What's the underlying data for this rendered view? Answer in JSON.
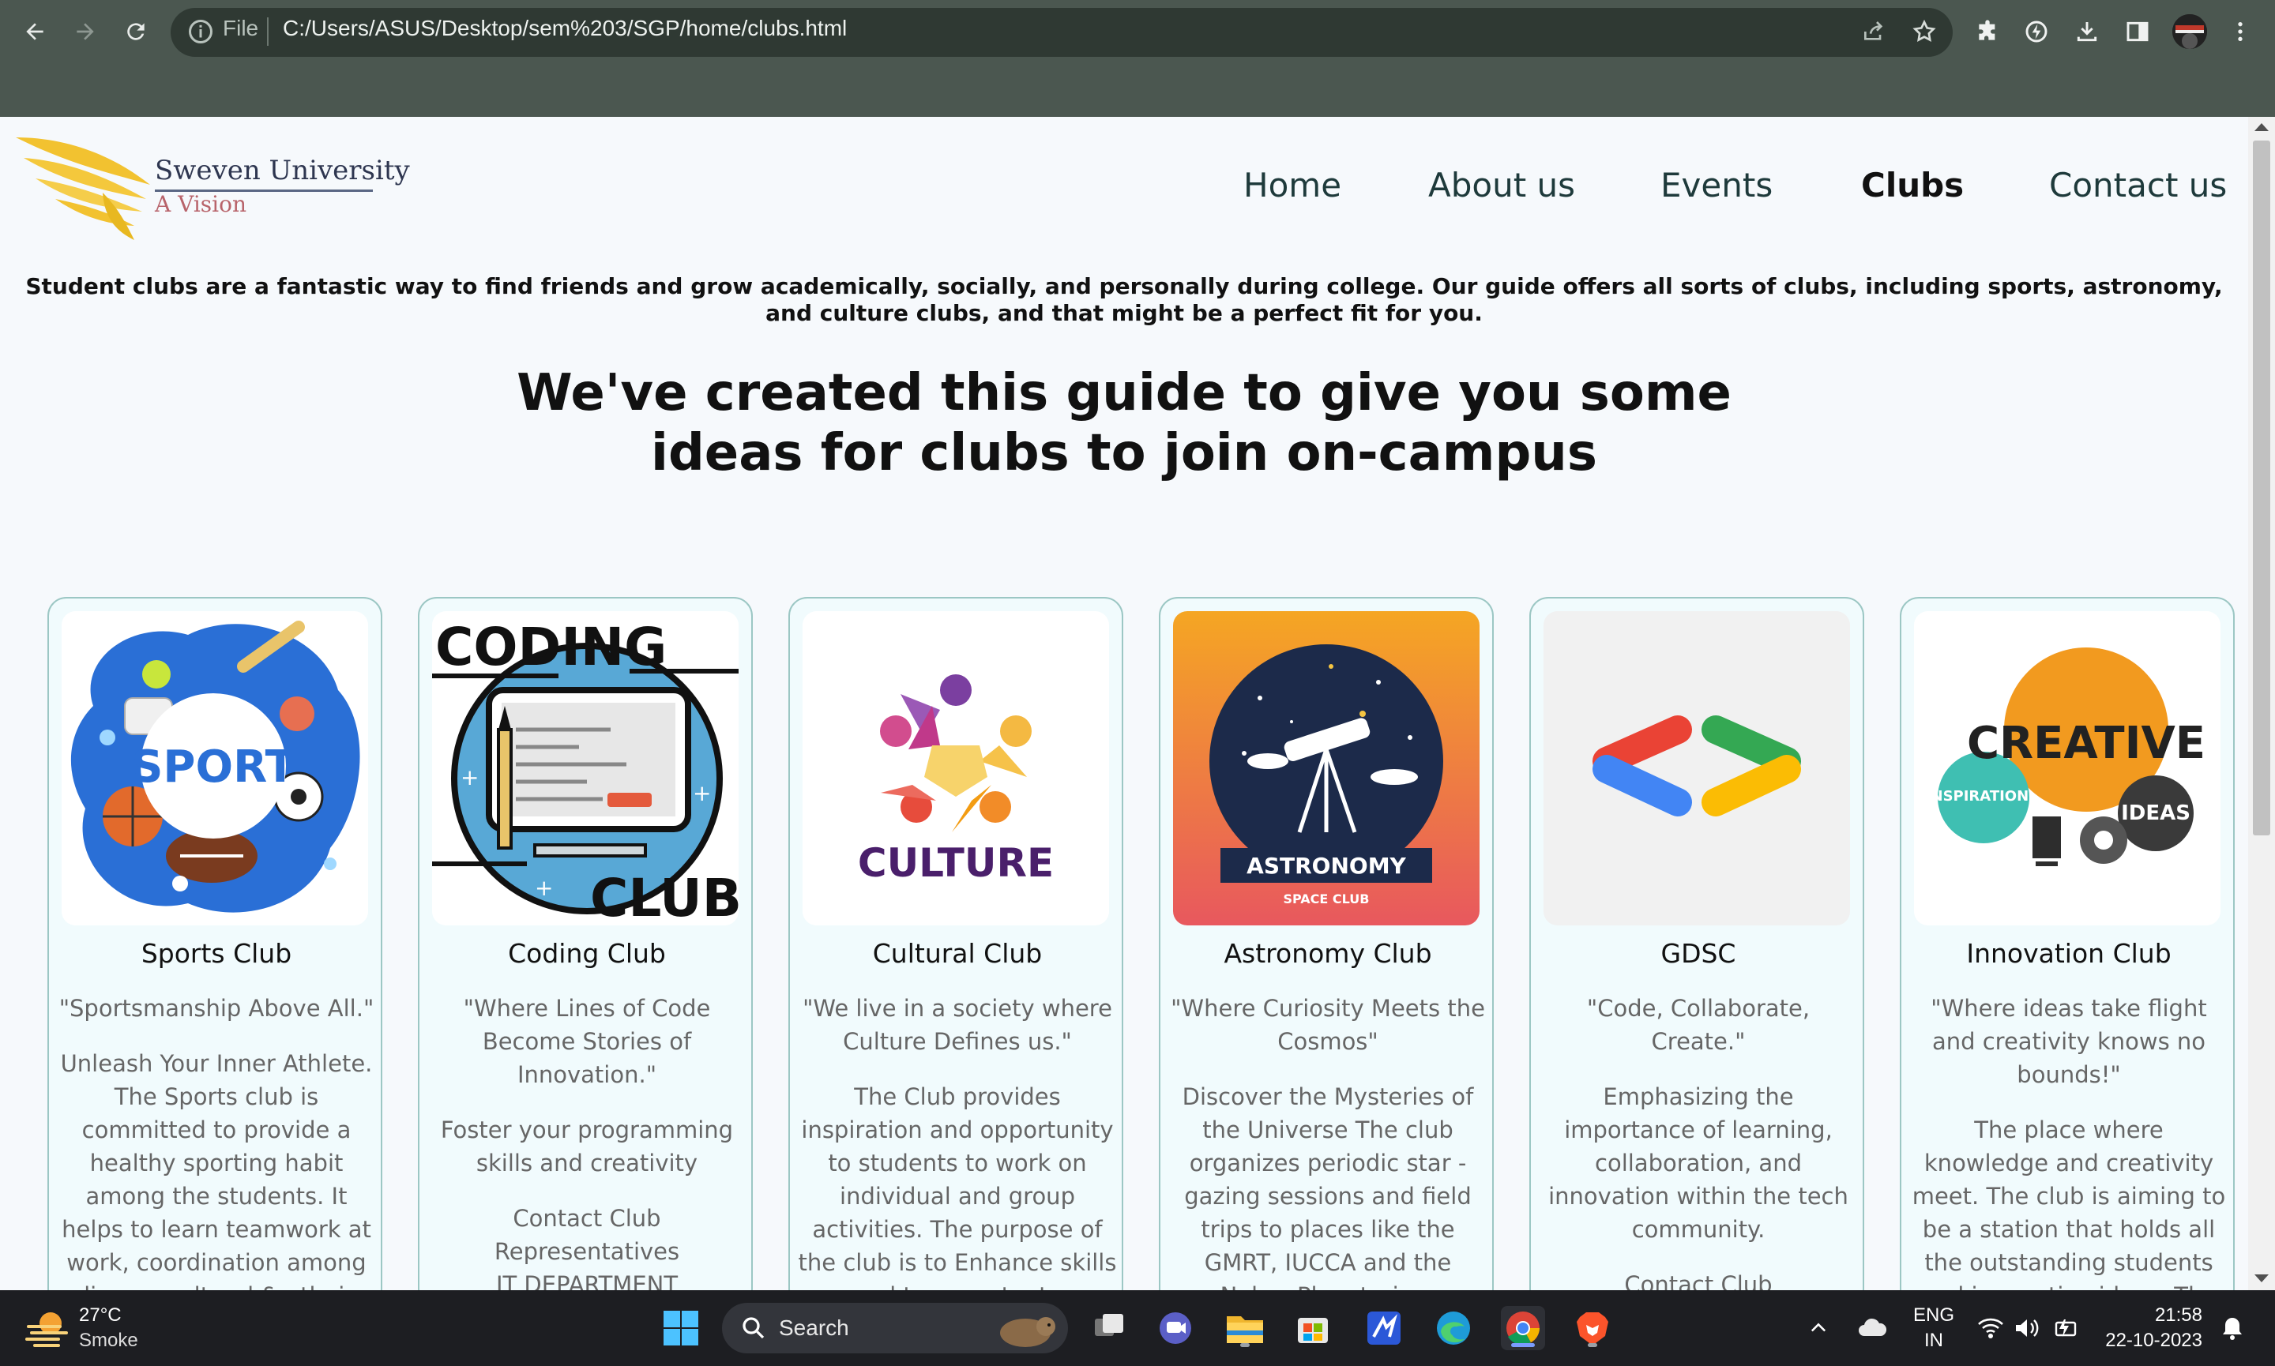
{
  "browser": {
    "scheme_label": "File",
    "url": "C:/Users/ASUS/Desktop/sem%203/SGP/home/clubs.html"
  },
  "site": {
    "logo_name": "Sweven University",
    "logo_tagline": "A Vision",
    "nav": [
      {
        "label": "Home",
        "active": false
      },
      {
        "label": "About us",
        "active": false
      },
      {
        "label": "Events",
        "active": false
      },
      {
        "label": "Clubs",
        "active": true
      },
      {
        "label": "Contact us",
        "active": false
      }
    ],
    "intro": "Student clubs are a fantastic way to find friends and grow academically, socially, and personally during college. Our guide offers all sorts of clubs, including sports, astronomy, and culture clubs, and that might be a perfect fit for you.",
    "headline": [
      "We've created this guide to give you some",
      "ideas for clubs to join on-campus"
    ]
  },
  "cards": [
    {
      "title": "Sports Club",
      "image_text": "SPORT",
      "quote": "\"Sportsmanship Above All.\"",
      "desc": "Unleash Your Inner Athlete. The Sports club is committed to provide a healthy sporting habit among the students. It helps to learn teamwork at work, coordination among diverse cultural & ethnic"
    },
    {
      "title": "Coding Club",
      "image_text_top": "CODING",
      "image_text_bottom": "CLUB",
      "quote": "\"Where Lines of Code Become Stories of Innovation.\"",
      "desc": "Foster your programming skills and creativity",
      "contact": "Contact Club Representatives",
      "dept": "IT DEPARTMENT"
    },
    {
      "title": "Cultural Club",
      "image_text": "CULTURE",
      "quote": "\"We live in a society where Culture Defines us.\"",
      "desc": "The Club provides inspiration and opportunity to students to work on individual and group activities. The purpose of the club is to Enhance skills and to accentuate"
    },
    {
      "title": "Astronomy Club",
      "image_text": "ASTRONOMY",
      "image_subtext": "SPACE CLUB",
      "quote": "\"Where Curiosity Meets the Cosmos\"",
      "desc": "Discover the Mysteries of the Universe The club organizes periodic star - gazing sessions and field trips to places like the GMRT, IUCCA and the Nehru Planetarium"
    },
    {
      "title": "GDSC",
      "quote": "\"Code, Collaborate, Create.\"",
      "desc": "Emphasizing the importance of learning, collaboration, and innovation within the tech community.",
      "contact": "Contact Club"
    },
    {
      "title": "Innovation Club",
      "image_text": "CREATIVE",
      "image_text_left": "INSPIRATION",
      "image_text_right": "IDEAS",
      "quote": "\"Where ideas take flight and creativity knows no bounds!\"",
      "desc": "The place where knowledge and creativity meet. The club is aiming to be a station that holds all the outstanding students and innovative ideas. The"
    }
  ],
  "taskbar": {
    "weather_temp": "27°C",
    "weather_cond": "Smoke",
    "search_label": "Search",
    "lang": "ENG",
    "region": "IN",
    "time": "21:58",
    "date": "22-10-2023"
  },
  "colors": {
    "chrome": "#4b5750",
    "page_bg": "#f6f9fc",
    "card_border": "#9cc7c4",
    "card_bg": "#f1fbfd",
    "taskbar": "#1d1e22"
  }
}
